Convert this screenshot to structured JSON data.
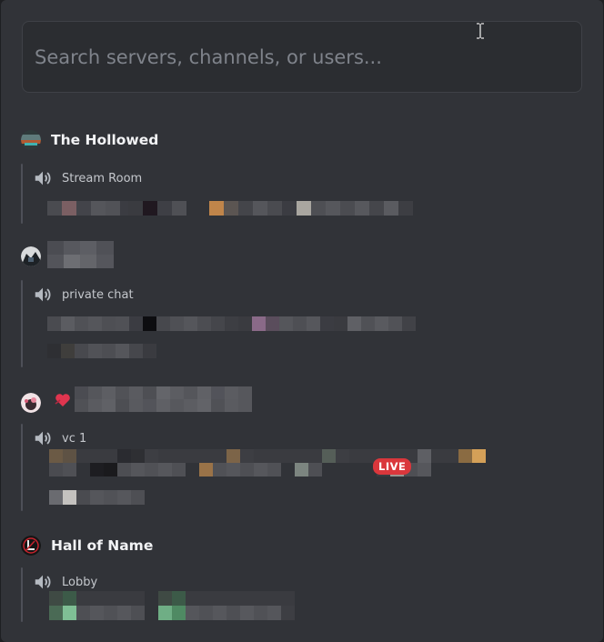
{
  "search": {
    "placeholder": "Search servers, channels, or users...",
    "value": ""
  },
  "servers": [
    {
      "name": "The Hollowed",
      "icon": "server-avatar-icon",
      "channels": [
        {
          "name": "Stream Room",
          "icon": "speaker-icon"
        }
      ]
    },
    {
      "name": "",
      "icon": "server-avatar-icon",
      "channels": [
        {
          "name": "private chat",
          "icon": "speaker-icon"
        }
      ]
    },
    {
      "name": "",
      "icon": "server-avatar-icon",
      "channels": [
        {
          "name": "vc 1",
          "icon": "speaker-icon",
          "badge": "LIVE"
        }
      ]
    },
    {
      "name": "Hall of Name",
      "icon": "server-avatar-icon",
      "channels": [
        {
          "name": "Lobby",
          "icon": "speaker-icon"
        }
      ]
    }
  ],
  "colors": {
    "background": "#313338",
    "search_bg": "#2b2d31",
    "live_badge": "#da373c",
    "heart": "#e0354f"
  }
}
